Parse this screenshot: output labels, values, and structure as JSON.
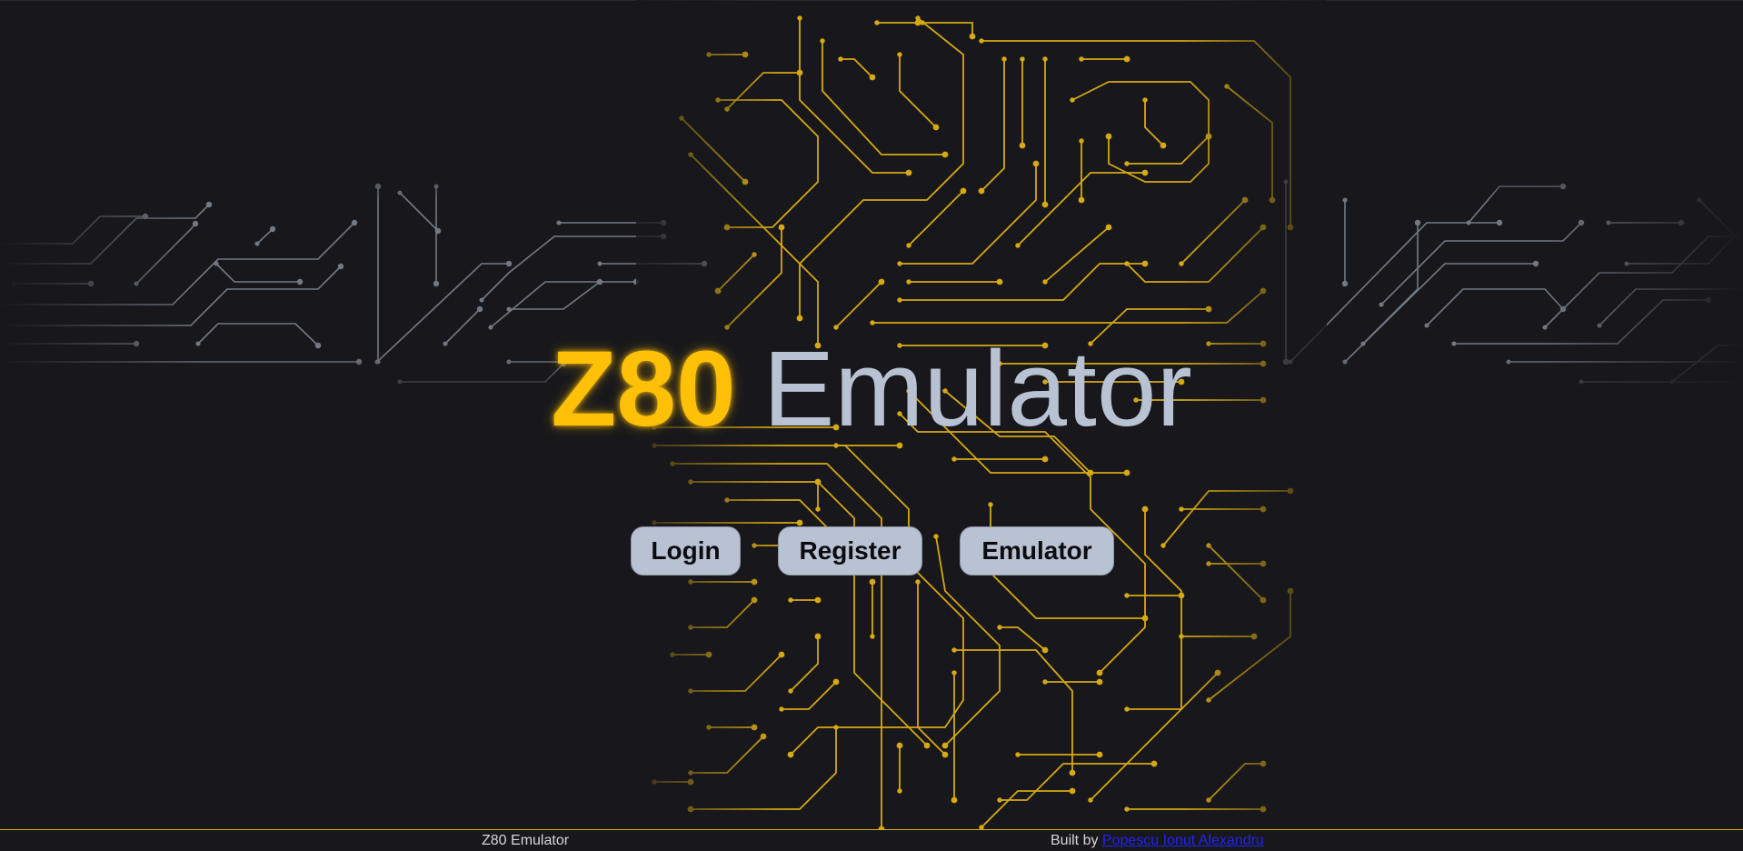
{
  "hero": {
    "title_accent": "Z80",
    "title_rest": "Emulator"
  },
  "nav": {
    "login_label": "Login",
    "register_label": "Register",
    "emulator_label": "Emulator"
  },
  "footer": {
    "app_name": "Z80 Emulator",
    "credit_prefix": "Built by",
    "author_name": "Popescu Ionut Alexandru"
  },
  "colors": {
    "background": "#18181c",
    "accent_gold": "#ffc107",
    "circuit_gold": "#d6a812",
    "circuit_gray": "#8a929e",
    "title_gray": "#b9c2d3",
    "button_bg": "#b9c2d3",
    "link_blue": "#2323ee"
  },
  "icons": {
    "background": "circuit-board-pattern"
  }
}
